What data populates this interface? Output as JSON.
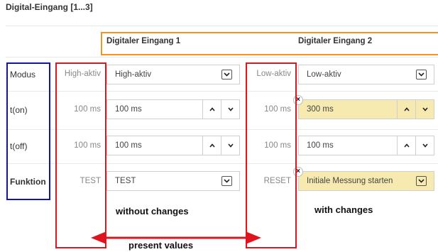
{
  "panel": {
    "title": "Digital-Eingang [1...3]"
  },
  "columns": {
    "input1": "Digitaler Eingang 1",
    "input2": "Digitaler Eingang 2"
  },
  "rows": {
    "modus": {
      "label": "Modus",
      "in1": {
        "present": "High-aktiv",
        "value": "High-aktiv"
      },
      "in2": {
        "present": "Low-aktiv",
        "value": "Low-aktiv"
      }
    },
    "ton": {
      "label": "t(on)",
      "in1": {
        "present": "100 ms",
        "value": "100 ms"
      },
      "in2": {
        "present": "100 ms",
        "value": "300 ms"
      }
    },
    "toff": {
      "label": "t(off)",
      "in1": {
        "present": "100 ms",
        "value": "100 ms"
      },
      "in2": {
        "present": "100 ms",
        "value": "100 ms"
      }
    },
    "funktion": {
      "label": "Funktion",
      "in1": {
        "present": "TEST",
        "value": "TEST"
      },
      "in2": {
        "present": "RESET",
        "value": "Initiale Messung starten"
      }
    }
  },
  "annotations": {
    "without_changes": "without changes",
    "with_changes": "with changes",
    "present_values": "present values",
    "reset_symbol": "×"
  },
  "colors": {
    "present_box": "#e0141e",
    "labels_box": "#1010c8",
    "header_box": "#f0961e",
    "changed_field": "#f7eab0"
  },
  "icons": {
    "dropdown": "chevron-down-icon",
    "spin_up": "chevron-up-icon",
    "spin_down": "chevron-down-icon",
    "reset": "close-icon"
  }
}
